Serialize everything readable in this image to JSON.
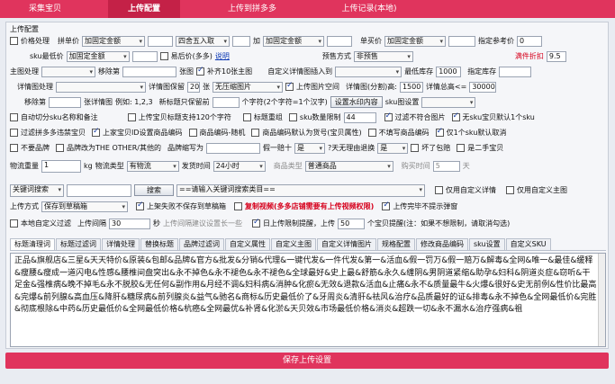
{
  "nav": {
    "tabs": [
      "采集宝贝",
      "上传配置",
      "上传到拼多多",
      "上传记录(本地)"
    ]
  },
  "section": "上传配置",
  "r1": {
    "price_cb": "价格处理",
    "pin_label": "拼单价",
    "sel1": "加固定金额",
    "in1": "",
    "sel2": "四舍五入取",
    "plus": "加",
    "sel3": "加固定金额",
    "in2": "",
    "single_label": "单买价",
    "sel4": "加固定金额",
    "in3": "",
    "ref_label": "指定参考价",
    "in4": "0"
  },
  "r2": {
    "sku_min_label": "sku最低价",
    "sel1": "加固定金额",
    "in1": "",
    "yixiao": "易后价(多多)",
    "tip": "说明",
    "preset_label": "预售方式",
    "preset_sel": "非预售",
    "discount_label": "满件折扣",
    "discount_val": "9.5"
  },
  "r3": {
    "main_img_label": "主图处理",
    "sel1": "",
    "move_label": "移除第",
    "in1": "",
    "zhang": "张图",
    "cb_fill": "补齐10张主图",
    "custom_detail_label": "自定义详情图插入到",
    "sel2": "",
    "min_stock_label": "最低库存",
    "min_stock": "1000",
    "spec_stock_label": "指定库存",
    "spec_stock": ""
  },
  "r4": {
    "detail_label": "详情图处理",
    "sel1": "",
    "keep_label": "详情图保留",
    "keep_val": "20",
    "zhang": "张",
    "sel2": "无压缩图片",
    "cb_space": "上传图片空间",
    "split_label": "详情图(分割)高:",
    "split_val": "1500",
    "total_label": "详情总高<=",
    "total_val": "30000"
  },
  "r5": {
    "remove_label": "移除第",
    "in1": "",
    "zhang": "张详情图",
    "example": "例如: 1,2,3",
    "new_title_label": "新标题只保留前",
    "in2": "",
    "chars": "个字符(2个字符=1个汉字)",
    "btn_wm": "设置水印内容",
    "sku_label": "sku图设置",
    "sku_sel": ""
  },
  "r6": {
    "cb1": "自动切分sku名称和备注",
    "cb2": "上传宝贝标题支持120个字符",
    "cb3": "标题重组",
    "sku_limit_label": "sku数量限制",
    "sku_limit": "44",
    "cb4": "过滤不符合图片",
    "cb5": "无sku宝贝默认1个sku"
  },
  "r7": {
    "cb1": "过滤拼多多违禁宝贝",
    "cb2": "上家宝贝ID设置商品编码",
    "cb3": "商品编码-随机",
    "cb4": "商品编码默认为货号(宝贝属性)",
    "cb5": "不填写商品编码",
    "cb6": "仅1个sku默认取消"
  },
  "r8": {
    "cb1": "不要品牌",
    "cb2": "品牌改为THE OTHER/其他的",
    "brand_abbr_label": "品牌缩写为",
    "in1": "",
    "fake_label": "假一赔十",
    "fake_sel": "是",
    "days_label": "?天无理由退换",
    "days_sel": "是",
    "cb3": "坏了包赔",
    "cb4": "是二手宝贝"
  },
  "r9": {
    "weight_label": "物流重量",
    "weight": "1",
    "kg": "kg",
    "type_label": "物流类型",
    "type_sel": "有物流",
    "ship_label": "发货时间",
    "ship_sel": "24小时",
    "cat_label": "商品类型",
    "cat_sel": "普通商品",
    "buy_limit_label": "购买时间",
    "buy_limit": "5",
    "day": "天"
  },
  "r10": {
    "kw_sel": "关键词搜索",
    "kw_in": "",
    "search_btn": "搜索",
    "cat_sel": "==请输入关键词搜索类目==",
    "cb1": "仅用自定义详情",
    "cb2": "仅用自定义主图"
  },
  "r11": {
    "upload_label": "上传方式",
    "upload_sel": "保存到草稿箱",
    "cb1": "上架失败不保存到草稿箱",
    "cb2": "复制视频(多多店铺需要有上传视频权限)",
    "cb3": "上传完毕不提示弹窗"
  },
  "r12": {
    "cb1": "本地自定义过滤",
    "interval_label": "上传间隔",
    "interval": "30",
    "sec": "秒",
    "hint": "上传间隔建议设置长一些",
    "cb2": "日上传限制提醒，上传",
    "limit": "50",
    "warn": "个宝贝提醒(注：如果不想限制，请取消勾选)"
  },
  "tabs": [
    "标题清理词",
    "标题过滤词",
    "详情处理",
    "替换标题",
    "品牌过滤词",
    "自定义属性",
    "自定义主图",
    "自定义详情图片",
    "规格配置",
    "修改商品编码",
    "sku设置",
    "自定义SKU"
  ],
  "title_clean_words": "正品&旗舰店&三星&天天特价&原装&包邮&品牌&官方&批发&分销&代理&一键代发&一件代发&第一&活血&假一罚万&假一赔万&解毒&全网&唯一&最佳&缓释&瘦腰&瘦成一道闪电&性感&腰椎间盘突出&永不掉色&永不褪色&永不褪色&全球最好&史上最&舒筋&永久&缠阴&男阴道紧缩&助孕&妇科&阴道炎症&窃听&干足金&强椎病&晚不掉毛&永不脱胶&无任何&副作用&月经不调&妇科病&消肿&化瘀&无效&退款&活血&止痛&永不&质量最牛&火爆&很好&史无前例&性价比最高&完爆&前列腺&高血压&降肝&糖尿病&前列腺炎&益气&驰名&商标&历史最低价了&牙周炎&清肝&祛风&治疗&品质最好的证&排毒&永不掉色&全网最低价&完胜&彻底根除&中药&历史最低价&全网最低价格&杭癌&全网最优&补肾&化淤&天贝效&市场最低价格&消炎&超跌一切&永不漏水&治疗强病&祖",
  "save_btn": "保存上传设置"
}
